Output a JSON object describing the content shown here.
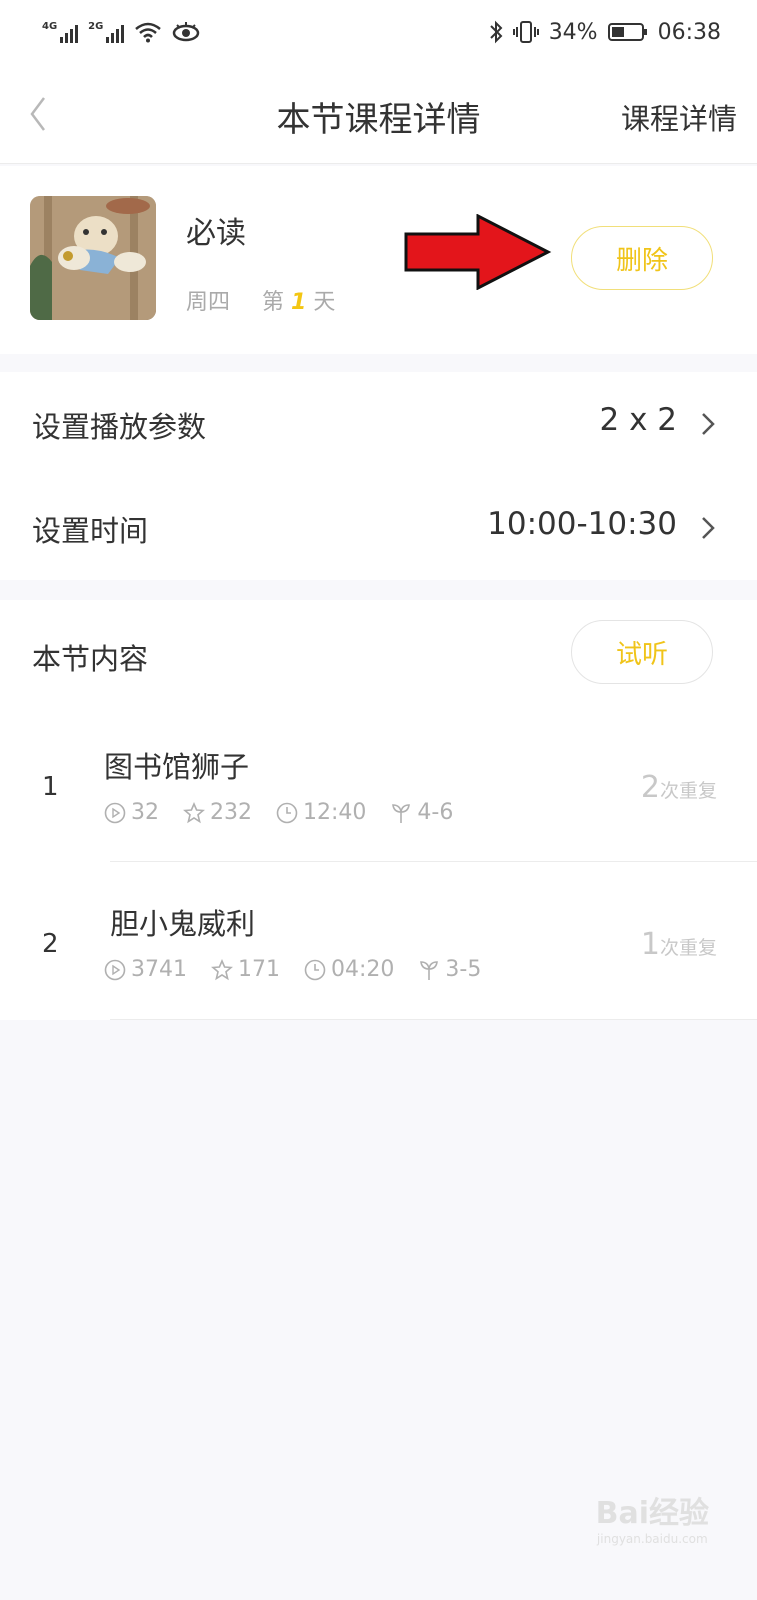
{
  "status_bar": {
    "network1": "4G",
    "network2": "2G",
    "battery": "34%",
    "time": "06:38"
  },
  "nav": {
    "title": "本节课程详情",
    "right_link": "课程详情"
  },
  "course": {
    "name": "必读",
    "weekday": "周四",
    "day_prefix": "第",
    "day_number": "1",
    "day_suffix": "天",
    "delete_label": "删除"
  },
  "settings": [
    {
      "label": "设置播放参数",
      "value": "2 x 2"
    },
    {
      "label": "设置时间",
      "value": "10:00-10:30"
    }
  ],
  "content": {
    "title": "本节内容",
    "try_label": "试听",
    "items": [
      {
        "index": "1",
        "title": "图书馆狮子",
        "plays": "32",
        "stars": "232",
        "duration": "12:40",
        "age": "4-6",
        "repeat_count": "2",
        "repeat_label": "次重复"
      },
      {
        "index": "2",
        "title": "胆小鬼威利",
        "plays": "3741",
        "stars": "171",
        "duration": "04:20",
        "age": "3-5",
        "repeat_count": "1",
        "repeat_label": "次重复"
      }
    ]
  },
  "watermark": {
    "logo": "Bai经验",
    "url": "jingyan.baidu.com"
  },
  "colors": {
    "accent": "#f0c419",
    "arrow": "#e3151b"
  }
}
